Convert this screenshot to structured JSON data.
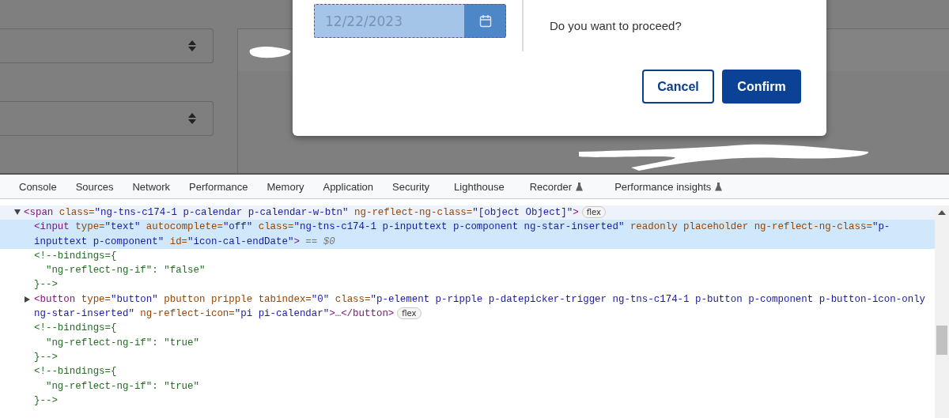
{
  "dialog": {
    "date_field": {
      "value": "12/22/2023",
      "inspected": true
    },
    "message": "Do you want to proceed?",
    "buttons": [
      {
        "label": "Cancel",
        "kind": "secondary"
      },
      {
        "label": "Confirm",
        "kind": "primary"
      }
    ]
  },
  "devtools": {
    "tabs": [
      {
        "label": "Console",
        "selected": false,
        "experimental": false
      },
      {
        "label": "Sources",
        "selected": false,
        "experimental": false
      },
      {
        "label": "Network",
        "selected": false,
        "experimental": false
      },
      {
        "label": "Performance",
        "selected": false,
        "experimental": false
      },
      {
        "label": "Memory",
        "selected": false,
        "experimental": false
      },
      {
        "label": "Application",
        "selected": false,
        "experimental": false
      },
      {
        "label": "Security",
        "selected": false,
        "experimental": false
      },
      {
        "label": "Lighthouse",
        "selected": false,
        "experimental": false
      },
      {
        "label": "Recorder",
        "selected": false,
        "experimental": true
      },
      {
        "label": "Performance insights",
        "selected": false,
        "experimental": true
      }
    ],
    "dom_tree": [
      {
        "kind": "element",
        "expanded": true,
        "selected": false,
        "hovered": true,
        "badge": "flex",
        "tokens": [
          {
            "kind": "tag",
            "text": "<span"
          },
          {
            "kind": "attr",
            "text": " class="
          },
          {
            "kind": "value",
            "text": "\"ng-tns-c174-1 p-calendar p-calendar-w-btn\""
          },
          {
            "kind": "attr",
            "text": " ng-reflect-ng-class="
          },
          {
            "kind": "value",
            "text": "\"[object Object]\""
          },
          {
            "kind": "tag",
            "text": ">"
          }
        ],
        "children": [
          {
            "kind": "element",
            "selected": true,
            "hovered": false,
            "tokens": [
              {
                "kind": "tag",
                "text": "<input"
              },
              {
                "kind": "attr",
                "text": " type="
              },
              {
                "kind": "value",
                "text": "\"text\""
              },
              {
                "kind": "attr",
                "text": " autocomplete="
              },
              {
                "kind": "value",
                "text": "\"off\""
              },
              {
                "kind": "attr",
                "text": " class="
              },
              {
                "kind": "value",
                "text": "\"ng-tns-c174-1 p-inputtext p-component ng-star-inserted\""
              },
              {
                "kind": "attr",
                "text": " readonly placeholder ng-reflect-ng-class="
              },
              {
                "kind": "value",
                "text": "\"p-inputtext p-component\""
              },
              {
                "kind": "attr",
                "text": " id="
              },
              {
                "kind": "value",
                "text": "\"icon-cal-endDate\""
              },
              {
                "kind": "tag",
                "text": ">"
              },
              {
                "kind": "ref",
                "text": " == $0"
              }
            ]
          },
          {
            "kind": "comment",
            "selected": false,
            "hovered": false,
            "text": "<!--bindings={\n  \"ng-reflect-ng-if\": \"false\"\n}-->"
          },
          {
            "kind": "element",
            "expanded": false,
            "selected": false,
            "hovered": false,
            "badge": "flex",
            "tokens": [
              {
                "kind": "tag",
                "text": "<button"
              },
              {
                "kind": "attr",
                "text": " type="
              },
              {
                "kind": "value",
                "text": "\"button\""
              },
              {
                "kind": "attr",
                "text": " pbutton pripple tabindex="
              },
              {
                "kind": "value",
                "text": "\"0\""
              },
              {
                "kind": "attr",
                "text": " class="
              },
              {
                "kind": "value",
                "text": "\"p-element p-ripple p-datepicker-trigger ng-tns-c174-1 p-button p-component p-button-icon-only ng-star-inserted\""
              },
              {
                "kind": "attr",
                "text": " ng-reflect-icon="
              },
              {
                "kind": "value",
                "text": "\"pi pi-calendar\""
              },
              {
                "kind": "tag",
                "text": ">…</button>"
              }
            ]
          },
          {
            "kind": "comment",
            "selected": false,
            "hovered": false,
            "text": "<!--bindings={\n  \"ng-reflect-ng-if\": \"true\"\n}-->"
          },
          {
            "kind": "comment",
            "selected": false,
            "hovered": false,
            "text": "<!--bindings={\n  \"ng-reflect-ng-if\": \"true\"\n}-->"
          }
        ]
      }
    ]
  }
}
